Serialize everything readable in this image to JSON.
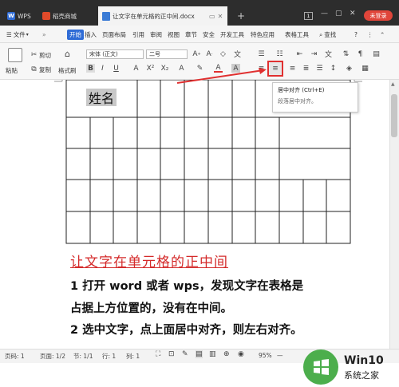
{
  "tabs": [
    {
      "label": "WPS",
      "icon": "wps-logo-icon"
    },
    {
      "label": "稻壳商城",
      "icon": "docer-logo-icon"
    },
    {
      "label": "让文字在单元格的正中间.docx",
      "icon": "document-icon"
    }
  ],
  "titlebar": {
    "page_badge": "1",
    "login": "未登录"
  },
  "menu": {
    "file": "文件",
    "items": [
      "开始",
      "插入",
      "页面布局",
      "引用",
      "审阅",
      "视图",
      "章节",
      "安全",
      "开发工具",
      "特色应用",
      "表格工具"
    ],
    "search": "查找"
  },
  "ribbon": {
    "paste": "粘贴",
    "cut": "剪切",
    "copy": "复制",
    "format_painter": "格式刷",
    "font_name": "宋体 (正文)",
    "font_size": "二号"
  },
  "tooltip": {
    "title": "居中对齐 (Ctrl+E)",
    "desc": "段落居中对齐。"
  },
  "document": {
    "cell_text": "姓名",
    "heading": "让文字在单元格的正中间",
    "line1": "1 打开 word 或者 wps，发现文字在表格是",
    "line2": "占据上方位置的，没有在中间。",
    "line3": "2 选中文字，点上面居中对齐，则左右对齐。"
  },
  "status": {
    "page": "页码: 1",
    "pages": "页面: 1/2",
    "section": "节: 1/1",
    "line": "行: 1",
    "col": "列: 1",
    "zoom": "95%"
  },
  "watermark": {
    "brand": "Win10",
    "site": "系统之家"
  },
  "colors": {
    "accent": "#2f6cd6",
    "highlight": "#e03030",
    "heading": "#d42a2a",
    "watermark_green": "#4cae4c"
  }
}
